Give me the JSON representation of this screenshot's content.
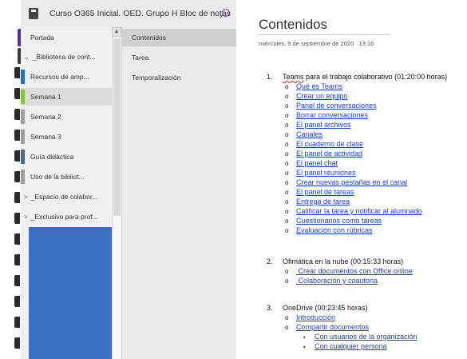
{
  "notebook": {
    "title": "Curso O365 Inicial. OED. Grupo H Bloc de notas"
  },
  "sections": {
    "items": [
      {
        "label": "Portada",
        "type": "section",
        "color": "#f0f0f0"
      },
      {
        "label": "_Biblioteca de cont...",
        "type": "group-expanded",
        "chevron": "⌄"
      },
      {
        "label": "Recursos de amp...",
        "type": "section",
        "color": "#2c6fb5"
      },
      {
        "label": "Semana 1",
        "type": "section",
        "color": "#84c341",
        "selected": true
      },
      {
        "label": "Semana 2",
        "type": "section",
        "color": "#9e9e9e"
      },
      {
        "label": "Semana 3",
        "type": "section",
        "color": "#9e9e9e"
      },
      {
        "label": "Guía didáctica",
        "type": "section",
        "color": "#4a6b8a"
      },
      {
        "label": "Uso de la bibliot...",
        "type": "section",
        "color": "#9e9e9e"
      },
      {
        "label": "_Espacio de colabor...",
        "type": "group-collapsed",
        "chevron": ">"
      },
      {
        "label": "_Exclusivo para prof...",
        "type": "group-collapsed",
        "chevron": ">"
      }
    ]
  },
  "pages": {
    "items": [
      {
        "label": "Contenidos",
        "selected": true
      },
      {
        "label": "Tarea"
      },
      {
        "label": "Temporalización"
      }
    ]
  },
  "content": {
    "title": "Contenidos",
    "date": "miércoles, 9 de septiembre de 2020",
    "time": "13:16",
    "list": [
      {
        "num": "1.",
        "prefix": "Teams",
        "text": " para el trabajo colaborativo (01:20:00 horas)",
        "children": [
          "Qué es Teams",
          "Crear un equipo",
          "Panel de conversaciones",
          "Borrar conversaciones",
          "El panel archivos",
          "Canales",
          "El cuaderno de clase",
          "El panel de actividad",
          "El panel chat",
          "El panel reuniones",
          "Crear nuevas pestañas en el canal",
          "El panel de tareas",
          "Entrega de tarea",
          "Calificar la tarea y notificar al alumnado",
          "Cuestionarios como tareas",
          "Evaluación con rúbricas"
        ]
      },
      {
        "num": "2.",
        "prefix": "",
        "text": "Ofimática en la nube (00:15:33 horas)",
        "children": [
          " Crear documentos con Office online",
          " Colaboración y coautoria"
        ]
      },
      {
        "num": "3.",
        "prefix": "",
        "text": "OneDrive (00:23:45 horas)",
        "children": [
          "Introducción",
          "Compartir documentos"
        ],
        "subchildren": [
          "Con usuarios de la organización",
          "Con cualquier persona"
        ]
      }
    ]
  }
}
